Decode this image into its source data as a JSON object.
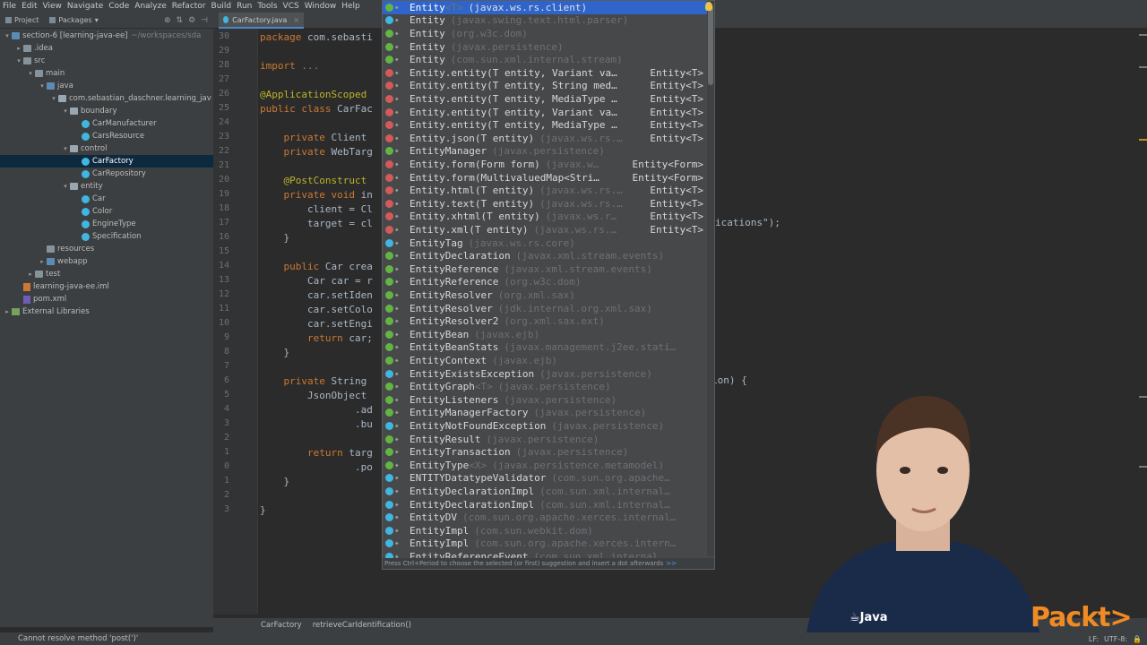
{
  "menu": [
    "File",
    "Edit",
    "View",
    "Navigate",
    "Code",
    "Analyze",
    "Refactor",
    "Build",
    "Run",
    "Tools",
    "VCS",
    "Window",
    "Help"
  ],
  "panel_tabs": {
    "project": "Project",
    "packages": "Packages"
  },
  "editor_tab": "CarFactory.java",
  "tree": [
    {
      "label": "section-6 [learning-java-ee]",
      "sub": "~/workspaces/sda"
    },
    {
      "label": ".idea"
    },
    {
      "label": "src"
    },
    {
      "label": "main"
    },
    {
      "label": "java"
    },
    {
      "label": "com.sebastian_daschner.learning_jav"
    },
    {
      "label": "boundary"
    },
    {
      "label": "CarManufacturer"
    },
    {
      "label": "CarsResource"
    },
    {
      "label": "control"
    },
    {
      "label": "CarFactory"
    },
    {
      "label": "CarRepository"
    },
    {
      "label": "entity"
    },
    {
      "label": "Car"
    },
    {
      "label": "Color"
    },
    {
      "label": "EngineType"
    },
    {
      "label": "Specification"
    },
    {
      "label": "resources"
    },
    {
      "label": "webapp"
    },
    {
      "label": "test"
    },
    {
      "label": "learning-java-ee.iml"
    },
    {
      "label": "pom.xml"
    },
    {
      "label": "External Libraries"
    }
  ],
  "line_numbers": [
    "30",
    "29",
    "28",
    "27",
    "26",
    "25",
    "24",
    "23",
    "22",
    "21",
    "20",
    "19",
    "18",
    "17",
    "16",
    "15",
    "14",
    "13",
    "12",
    "11",
    "10",
    "9",
    "8",
    "7",
    "6",
    "5",
    "4",
    "3",
    "2",
    "1",
    "0",
    "1",
    "2",
    "3"
  ],
  "code": [
    {
      "pre": "package ",
      "rest": "com.sebasti"
    },
    {
      "pre": "",
      "rest": ""
    },
    {
      "pre": "import ",
      "rest": "..."
    },
    {
      "pre": "",
      "rest": ""
    },
    {
      "pre": "@ApplicationScoped",
      "rest": ""
    },
    {
      "pre": "public class ",
      "rest": "CarFac"
    },
    {
      "pre": "",
      "rest": ""
    },
    {
      "pre": "    private ",
      "rest": "Client"
    },
    {
      "pre": "    private ",
      "rest": "WebTarg"
    },
    {
      "pre": "",
      "rest": ""
    },
    {
      "pre": "    @PostConstruct",
      "rest": ""
    },
    {
      "pre": "    private void ",
      "rest": "in"
    },
    {
      "pre": "",
      "rest": "        client = Cl"
    },
    {
      "pre": "",
      "rest": "        target = cl"
    },
    {
      "pre": "",
      "rest": "    }"
    },
    {
      "pre": "",
      "rest": ""
    },
    {
      "pre": "    public ",
      "rest": "Car crea"
    },
    {
      "pre": "",
      "rest": "        Car car = r"
    },
    {
      "pre": "",
      "rest": "        car.setIden"
    },
    {
      "pre": "",
      "rest": "        car.setColo"
    },
    {
      "pre": "",
      "rest": "        car.setEngi"
    },
    {
      "pre": "        return ",
      "rest": "car;"
    },
    {
      "pre": "",
      "rest": "    }"
    },
    {
      "pre": "",
      "rest": ""
    },
    {
      "pre": "    private ",
      "rest": "String"
    },
    {
      "pre": "",
      "rest": "        JsonObject"
    },
    {
      "pre": "",
      "rest": "                .ad"
    },
    {
      "pre": "",
      "rest": "                .bu"
    },
    {
      "pre": "",
      "rest": ""
    },
    {
      "pre": "        return ",
      "rest": "targ"
    },
    {
      "pre": "",
      "rest": "                .po"
    },
    {
      "pre": "",
      "rest": "    }"
    },
    {
      "pre": "",
      "rest": ""
    },
    {
      "pre": "",
      "rest": "}"
    }
  ],
  "code_right": {
    "line_18": "ications\");",
    "line_6": "ion) {"
  },
  "completion": {
    "items": [
      {
        "icon": "i",
        "name": "Entity",
        "gen": "<T>",
        "loc": "(javax.ws.rs.client)",
        "ret": "",
        "selected": true
      },
      {
        "icon": "c",
        "name": "Entity",
        "gen": "",
        "loc": "(javax.swing.text.html.parser)",
        "ret": ""
      },
      {
        "icon": "i",
        "name": "Entity",
        "gen": "",
        "loc": "(org.w3c.dom)",
        "ret": ""
      },
      {
        "icon": "i",
        "name": "Entity",
        "gen": "",
        "loc": "(javax.persistence)",
        "ret": ""
      },
      {
        "icon": "i",
        "name": "Entity",
        "gen": "",
        "loc": "(com.sun.xml.internal.stream)",
        "ret": ""
      },
      {
        "icon": "m",
        "name": "Entity.entity(T entity, Variant va…",
        "gen": "",
        "loc": "",
        "ret": "Entity<T>"
      },
      {
        "icon": "m",
        "name": "Entity.entity(T entity, String med…",
        "gen": "",
        "loc": "",
        "ret": "Entity<T>"
      },
      {
        "icon": "m",
        "name": "Entity.entity(T entity, MediaType …",
        "gen": "",
        "loc": "",
        "ret": "Entity<T>"
      },
      {
        "icon": "m",
        "name": "Entity.entity(T entity, Variant va…",
        "gen": "",
        "loc": "",
        "ret": "Entity<T>"
      },
      {
        "icon": "m",
        "name": "Entity.entity(T entity, MediaType …",
        "gen": "",
        "loc": "",
        "ret": "Entity<T>"
      },
      {
        "icon": "m",
        "name": "Entity.json(T entity)",
        "gen": "",
        "loc": "(javax.ws.rs.…",
        "ret": "Entity<T>"
      },
      {
        "icon": "i",
        "name": "EntityManager",
        "gen": "",
        "loc": "(javax.persistence)",
        "ret": ""
      },
      {
        "icon": "m",
        "name": "Entity.form(Form form)",
        "gen": "",
        "loc": "(javax.w…",
        "ret": "Entity<Form>"
      },
      {
        "icon": "m",
        "name": "Entity.form(MultivaluedMap<Stri…",
        "gen": "",
        "loc": "",
        "ret": "Entity<Form>"
      },
      {
        "icon": "m",
        "name": "Entity.html(T entity)",
        "gen": "",
        "loc": "(javax.ws.rs.…",
        "ret": "Entity<T>"
      },
      {
        "icon": "m",
        "name": "Entity.text(T entity)",
        "gen": "",
        "loc": "(javax.ws.rs.…",
        "ret": "Entity<T>"
      },
      {
        "icon": "m",
        "name": "Entity.xhtml(T entity)",
        "gen": "",
        "loc": "(javax.ws.r…",
        "ret": "Entity<T>"
      },
      {
        "icon": "m",
        "name": "Entity.xml(T entity)",
        "gen": "",
        "loc": "(javax.ws.rs.…",
        "ret": "Entity<T>"
      },
      {
        "icon": "c",
        "name": "EntityTag",
        "gen": "",
        "loc": "(javax.ws.rs.core)",
        "ret": ""
      },
      {
        "icon": "i",
        "name": "EntityDeclaration",
        "gen": "",
        "loc": "(javax.xml.stream.events)",
        "ret": ""
      },
      {
        "icon": "i",
        "name": "EntityReference",
        "gen": "",
        "loc": "(javax.xml.stream.events)",
        "ret": ""
      },
      {
        "icon": "i",
        "name": "EntityReference",
        "gen": "",
        "loc": "(org.w3c.dom)",
        "ret": ""
      },
      {
        "icon": "i",
        "name": "EntityResolver",
        "gen": "",
        "loc": "(org.xml.sax)",
        "ret": ""
      },
      {
        "icon": "i",
        "name": "EntityResolver",
        "gen": "",
        "loc": "(jdk.internal.org.xml.sax)",
        "ret": ""
      },
      {
        "icon": "i",
        "name": "EntityResolver2",
        "gen": "",
        "loc": "(org.xml.sax.ext)",
        "ret": ""
      },
      {
        "icon": "i",
        "name": "EntityBean",
        "gen": "",
        "loc": "(javax.ejb)",
        "ret": ""
      },
      {
        "icon": "i",
        "name": "EntityBeanStats",
        "gen": "",
        "loc": "(javax.management.j2ee.stati…",
        "ret": ""
      },
      {
        "icon": "i",
        "name": "EntityContext",
        "gen": "",
        "loc": "(javax.ejb)",
        "ret": ""
      },
      {
        "icon": "c",
        "name": "EntityExistsException",
        "gen": "",
        "loc": "(javax.persistence)",
        "ret": ""
      },
      {
        "icon": "i",
        "name": "EntityGraph",
        "gen": "<T>",
        "loc": "(javax.persistence)",
        "ret": ""
      },
      {
        "icon": "i",
        "name": "EntityListeners",
        "gen": "",
        "loc": "(javax.persistence)",
        "ret": ""
      },
      {
        "icon": "i",
        "name": "EntityManagerFactory",
        "gen": "",
        "loc": "(javax.persistence)",
        "ret": ""
      },
      {
        "icon": "c",
        "name": "EntityNotFoundException",
        "gen": "",
        "loc": "(javax.persistence)",
        "ret": ""
      },
      {
        "icon": "i",
        "name": "EntityResult",
        "gen": "",
        "loc": "(javax.persistence)",
        "ret": ""
      },
      {
        "icon": "i",
        "name": "EntityTransaction",
        "gen": "",
        "loc": "(javax.persistence)",
        "ret": ""
      },
      {
        "icon": "i",
        "name": "EntityType",
        "gen": "<X>",
        "loc": "(javax.persistence.metamodel)",
        "ret": ""
      },
      {
        "icon": "c",
        "name": "ENTITYDatatypeValidator",
        "gen": "",
        "loc": "(com.sun.org.apache…",
        "ret": ""
      },
      {
        "icon": "c",
        "name": "EntityDeclarationImpl",
        "gen": "",
        "loc": "(com.sun.xml.internal…",
        "ret": ""
      },
      {
        "icon": "c",
        "name": "EntityDeclarationImpl",
        "gen": "",
        "loc": "(com.sun.xml.internal…",
        "ret": ""
      },
      {
        "icon": "c",
        "name": "EntityDV",
        "gen": "",
        "loc": "(com.sun.org.apache.xerces.internal…",
        "ret": ""
      },
      {
        "icon": "c",
        "name": "EntityImpl",
        "gen": "",
        "loc": "(com.sun.webkit.dom)",
        "ret": ""
      },
      {
        "icon": "c",
        "name": "EntityImpl",
        "gen": "",
        "loc": "(com.sun.org.apache.xerces.intern…",
        "ret": ""
      },
      {
        "icon": "c",
        "name": "EntityReferenceEvent",
        "gen": "",
        "loc": "(com.sun.xml.internal…",
        "ret": ""
      }
    ],
    "footer": "Press Ctrl+Period to choose the selected (or first) suggestion and insert a dot afterwards",
    "footer_link": ">>"
  },
  "breadcrumbs": [
    "CarFactory",
    "retrieveCarIdentification()"
  ],
  "status_message": "Cannot resolve method 'post(')'",
  "status_right": [
    "LF:",
    "UTF-8:"
  ],
  "brand": {
    "java": "Java",
    "packt": "Packt>"
  }
}
